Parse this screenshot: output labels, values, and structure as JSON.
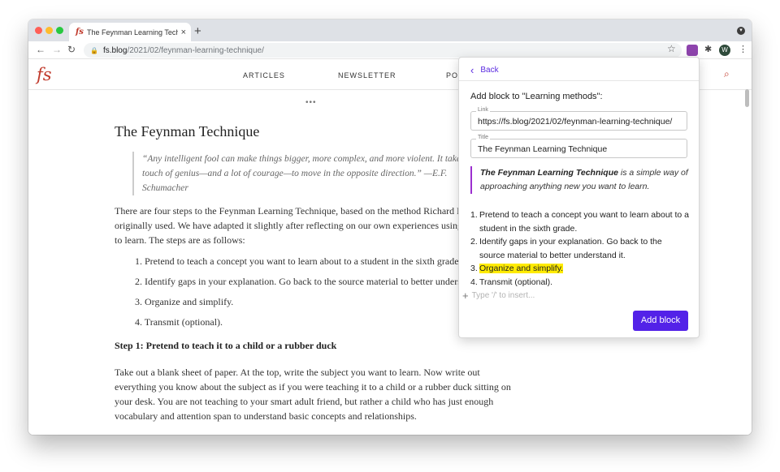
{
  "browser": {
    "tab_title": "The Feynman Learning Technique",
    "tab_favicon": "fs",
    "tab_close": "×",
    "new_tab": "+",
    "back": "←",
    "forward": "→",
    "reload": "↻",
    "lock": "🔒",
    "url_host": "fs.blog",
    "url_path": "/2021/02/feynman-learning-technique/",
    "star": "☆",
    "puzzle": "✱",
    "avatar_initial": "W",
    "kebab": "⋮",
    "tab_menu": "▾"
  },
  "site": {
    "logo": "fs",
    "nav": [
      "ARTICLES",
      "NEWSLETTER",
      "PO"
    ],
    "search": "⌕",
    "more": "•••"
  },
  "article": {
    "title": "The Feynman Technique",
    "quote": "“Any intelligent fool can make things bigger, more complex, and more violent. It takes a touch of genius—and a lot of courage—to move in the opposite direction.” —E.F. Schumacher",
    "intro": "There are four steps to the Feynman Learning Technique, based on the method Richard Feynman originally used. We have adapted it slightly after reflecting on our own experiences using this process to learn. The steps are as follows:",
    "steps": [
      "Pretend to teach a concept you want to learn about to a student in the sixth grade.",
      "Identify gaps in your explanation. Go back to the source material to better understand it.",
      "Organize and simplify.",
      "Transmit (optional)."
    ],
    "step1_heading": "Step 1: Pretend to teach it to a child or a rubber duck",
    "step1_body": "Take out a blank sheet of paper. At the top, write the subject you want to learn. Now write out everything you know about the subject as if you were teaching it to a child or a rubber duck sitting on your desk. You are not teaching to your smart adult friend, but rather a child who has just enough vocabulary and attention span to understand basic concepts and relationships."
  },
  "popup": {
    "back_label": "Back",
    "heading": "Add block to \"Learning methods\":",
    "link_label": "Link",
    "link_value": "https://fs.blog/2021/02/feynman-learning-technique/",
    "title_label": "Title",
    "title_value": "The Feynman Learning Technique",
    "callout_bold": "The Feynman Learning Technique",
    "callout_rest": " is a simple way of approaching anything new you want to learn.",
    "list": [
      {
        "num": "1.",
        "text": "Pretend to teach a concept you want to learn about to a student in the sixth grade."
      },
      {
        "num": "2.",
        "text": "Identify gaps in your explanation. Go back to the source material to better understand it."
      },
      {
        "num": "3.",
        "text": "Organize and simplify."
      },
      {
        "num": "4.",
        "text": "Transmit (optional)."
      }
    ],
    "insert_placeholder": "Type '/' to insert...",
    "add_button": "Add block",
    "accent": "#5322e8",
    "highlight": "#ffeb00"
  }
}
